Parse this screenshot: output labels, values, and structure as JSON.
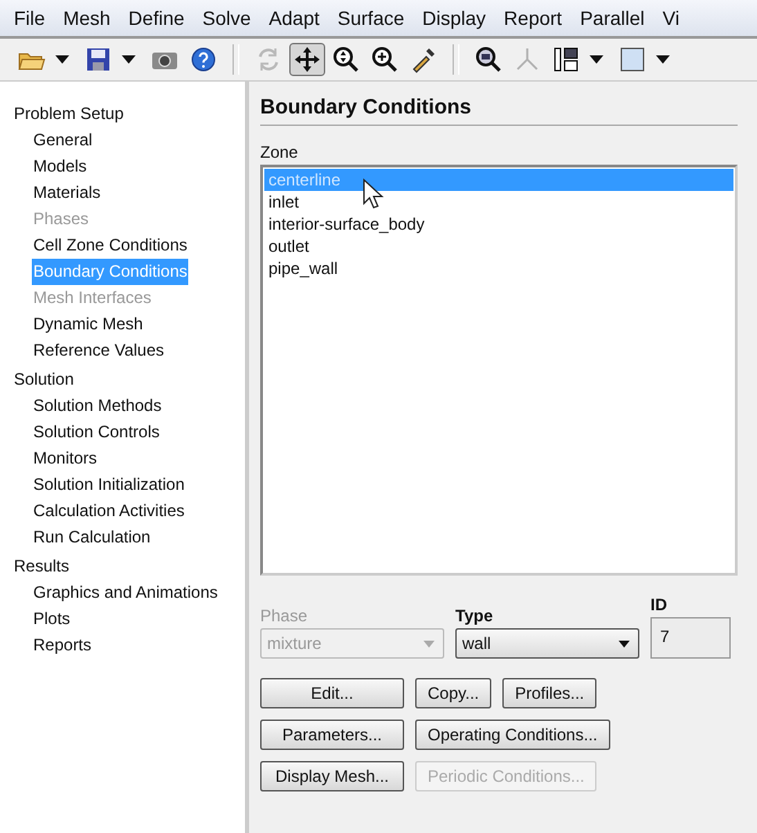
{
  "menu": [
    "File",
    "Mesh",
    "Define",
    "Solve",
    "Adapt",
    "Surface",
    "Display",
    "Report",
    "Parallel",
    "Vi"
  ],
  "toolbar": [
    {
      "kind": "open",
      "dropdown": true,
      "selected": false,
      "disabled": false
    },
    {
      "kind": "save",
      "dropdown": true,
      "selected": false,
      "disabled": false
    },
    {
      "kind": "camera",
      "selected": false,
      "disabled": false
    },
    {
      "kind": "help",
      "selected": false,
      "disabled": false
    },
    {
      "kind": "separator"
    },
    {
      "kind": "rotate",
      "selected": false,
      "disabled": true
    },
    {
      "kind": "move",
      "selected": true,
      "disabled": false
    },
    {
      "kind": "zoomfit",
      "selected": false,
      "disabled": false
    },
    {
      "kind": "zoomin",
      "selected": false,
      "disabled": false
    },
    {
      "kind": "probe",
      "selected": false,
      "disabled": false
    },
    {
      "kind": "separator"
    },
    {
      "kind": "zoombox",
      "selected": false,
      "disabled": false
    },
    {
      "kind": "axes",
      "selected": false,
      "disabled": true
    },
    {
      "kind": "layout",
      "dropdown": true,
      "selected": false,
      "disabled": false
    },
    {
      "kind": "view",
      "dropdown": true,
      "selected": false,
      "disabled": false
    }
  ],
  "sidebar": [
    {
      "label": "Problem Setup",
      "children": [
        {
          "label": "General",
          "selected": false,
          "disabled": false
        },
        {
          "label": "Models",
          "selected": false,
          "disabled": false
        },
        {
          "label": "Materials",
          "selected": false,
          "disabled": false
        },
        {
          "label": "Phases",
          "selected": false,
          "disabled": true
        },
        {
          "label": "Cell Zone Conditions",
          "selected": false,
          "disabled": false
        },
        {
          "label": "Boundary Conditions",
          "selected": true,
          "disabled": false
        },
        {
          "label": "Mesh Interfaces",
          "selected": false,
          "disabled": true
        },
        {
          "label": "Dynamic Mesh",
          "selected": false,
          "disabled": false
        },
        {
          "label": "Reference Values",
          "selected": false,
          "disabled": false
        }
      ]
    },
    {
      "label": "Solution",
      "children": [
        {
          "label": "Solution Methods",
          "selected": false,
          "disabled": false
        },
        {
          "label": "Solution Controls",
          "selected": false,
          "disabled": false
        },
        {
          "label": "Monitors",
          "selected": false,
          "disabled": false
        },
        {
          "label": "Solution Initialization",
          "selected": false,
          "disabled": false
        },
        {
          "label": "Calculation Activities",
          "selected": false,
          "disabled": false
        },
        {
          "label": "Run Calculation",
          "selected": false,
          "disabled": false
        }
      ]
    },
    {
      "label": "Results",
      "children": [
        {
          "label": "Graphics and Animations",
          "selected": false,
          "disabled": false
        },
        {
          "label": "Plots",
          "selected": false,
          "disabled": false
        },
        {
          "label": "Reports",
          "selected": false,
          "disabled": false
        }
      ]
    }
  ],
  "panel": {
    "title": "Boundary Conditions",
    "zone_label": "Zone",
    "zones": [
      {
        "label": "centerline",
        "selected": true
      },
      {
        "label": "inlet",
        "selected": false
      },
      {
        "label": "interior-surface_body",
        "selected": false
      },
      {
        "label": "outlet",
        "selected": false
      },
      {
        "label": "pipe_wall",
        "selected": false
      }
    ],
    "phase": {
      "label": "Phase",
      "value": "mixture",
      "disabled": true
    },
    "type": {
      "label": "Type",
      "value": "wall",
      "disabled": false
    },
    "id": {
      "label": "ID",
      "value": "7"
    },
    "button_rows": [
      [
        {
          "label": "Edit...",
          "disabled": false
        },
        {
          "label": "Copy...",
          "disabled": false
        },
        {
          "label": "Profiles...",
          "disabled": false
        }
      ],
      [
        {
          "label": "Parameters...",
          "disabled": false
        },
        {
          "label": "Operating Conditions...",
          "disabled": false
        }
      ],
      [
        {
          "label": "Display Mesh...",
          "disabled": false
        },
        {
          "label": "Periodic Conditions...",
          "disabled": true
        }
      ]
    ]
  }
}
